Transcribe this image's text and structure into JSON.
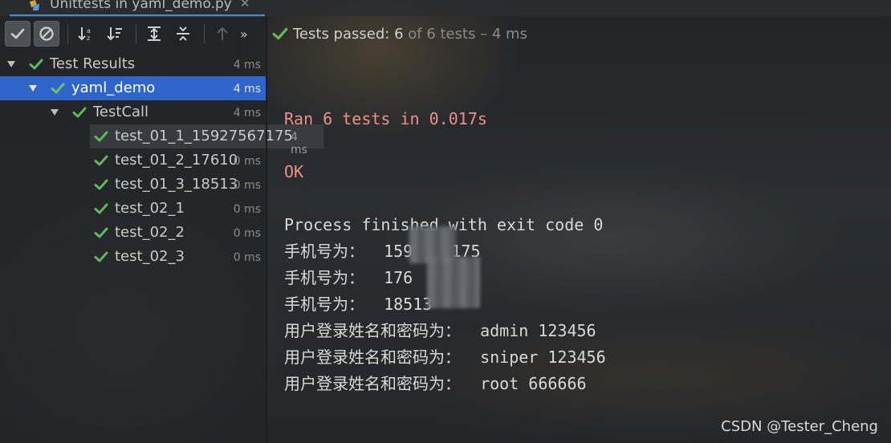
{
  "window": {
    "run_tab_title": "Unittests in yaml_demo.py",
    "tab_close_glyph": "✕"
  },
  "toolbar": {
    "show_passed": "show-passed-toggle",
    "show_ignored": "show-ignored-toggle",
    "sort_alpha": "sort-alphabetically",
    "sort_duration": "sort-by-duration",
    "expand_all": "expand-all",
    "collapse_all": "collapse-all",
    "prev_failed": "previous-failed-test",
    "more_glyph": "»"
  },
  "status": {
    "label": "Tests passed:",
    "count": "6",
    "rest": "of 6 tests – 4 ms"
  },
  "tree": {
    "root": {
      "label": "Test Results",
      "duration": "4 ms"
    },
    "module": {
      "label": "yaml_demo",
      "duration": "4 ms"
    },
    "class": {
      "label": "TestCall",
      "duration": "4 ms"
    },
    "tests": [
      {
        "label": "test_01_1_15927567175",
        "duration": "4 ms"
      },
      {
        "label": "test_01_2_17610",
        "duration": "0 ms"
      },
      {
        "label": "test_01_3_18513",
        "duration": "0 ms"
      },
      {
        "label": "test_02_1",
        "duration": "0 ms"
      },
      {
        "label": "test_02_2",
        "duration": "0 ms"
      },
      {
        "label": "test_02_3",
        "duration": "0 ms"
      }
    ]
  },
  "console": {
    "ran": "Ran 6 tests in 0.017s",
    "ok": "OK",
    "process": "Process finished with exit code 0",
    "phone_label": "手机号为：",
    "phones": [
      "159",
      "176",
      "18513"
    ],
    "phone_tail_1": "175",
    "user_label": "用户登录姓名和密码为：",
    "users": [
      "admin 123456",
      "sniper 123456",
      "root 666666"
    ]
  },
  "watermark": "CSDN @Tester_Cheng",
  "colors": {
    "pass_green": "#5fb85a",
    "selection": "#2f65ca",
    "error_text": "#f08f88"
  }
}
